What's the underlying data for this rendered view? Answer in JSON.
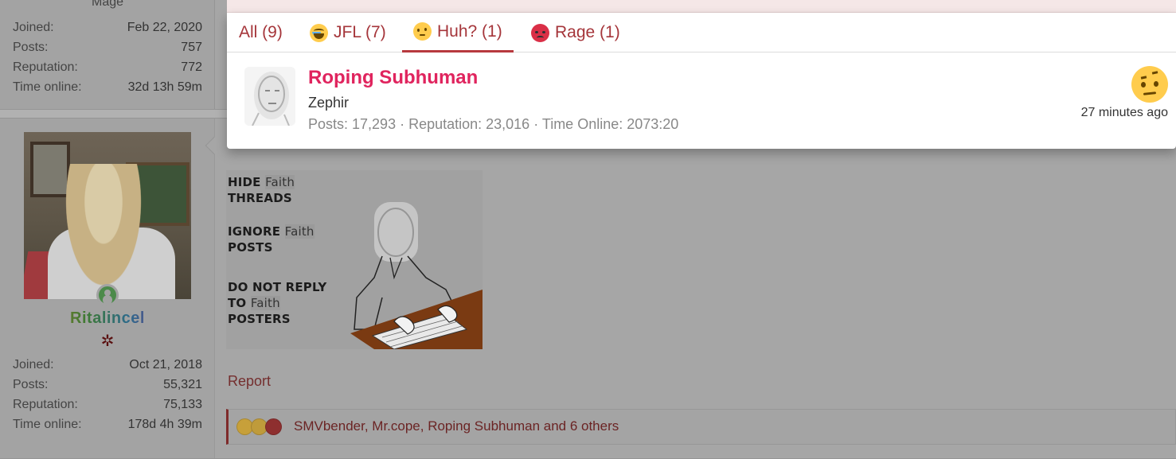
{
  "prev_user": {
    "rank_title": "Mage",
    "stats": [
      {
        "label": "Joined:",
        "value": "Feb 22, 2020"
      },
      {
        "label": "Posts:",
        "value": "757"
      },
      {
        "label": "Reputation:",
        "value": "772"
      },
      {
        "label": "Time online:",
        "value": "32d 13h 59m"
      }
    ]
  },
  "user": {
    "username": "Ritalincel",
    "stats": [
      {
        "label": "Joined:",
        "value": "Oct 21, 2018"
      },
      {
        "label": "Posts:",
        "value": "55,321"
      },
      {
        "label": "Reputation:",
        "value": "75,133"
      },
      {
        "label": "Time online:",
        "value": "178d 4h 39m"
      }
    ]
  },
  "post": {
    "signature": {
      "line1_a": "HIDE ",
      "line1_hl": "Faith",
      "line1_b": "THREADS",
      "line2_a": "IGNORE ",
      "line2_hl": "Faith",
      "line2_b": "POSTS",
      "line3_a": "DO NOT REPLY",
      "line3_b": "TO ",
      "line3_hl": "Faith",
      "line3_c": "POSTERS"
    },
    "report_label": "Report",
    "reactions_summary": "SMVbender, Mr.cope, Roping Subhuman and 6 others"
  },
  "reactions_popup": {
    "tabs": [
      {
        "label": "All (9)",
        "icon": null,
        "active": false
      },
      {
        "label": "JFL (7)",
        "icon": "jfl-emoji-icon",
        "active": false
      },
      {
        "label": "Huh? (1)",
        "icon": "huh-emoji-icon",
        "active": true
      },
      {
        "label": "Rage (1)",
        "icon": "rage-emoji-icon",
        "active": false
      }
    ],
    "entries": [
      {
        "name": "Roping Subhuman",
        "title": "Zephir",
        "stats": "Posts: 17,293 · Reputation: 23,016 · Time Online: 2073:20",
        "reaction_icon": "raised-eyebrow-emoji-icon",
        "time": "27 minutes ago"
      }
    ]
  },
  "colors": {
    "accent": "#a5353a",
    "username_pink": "#e0245e",
    "dim_background": "#a7a7a7"
  }
}
